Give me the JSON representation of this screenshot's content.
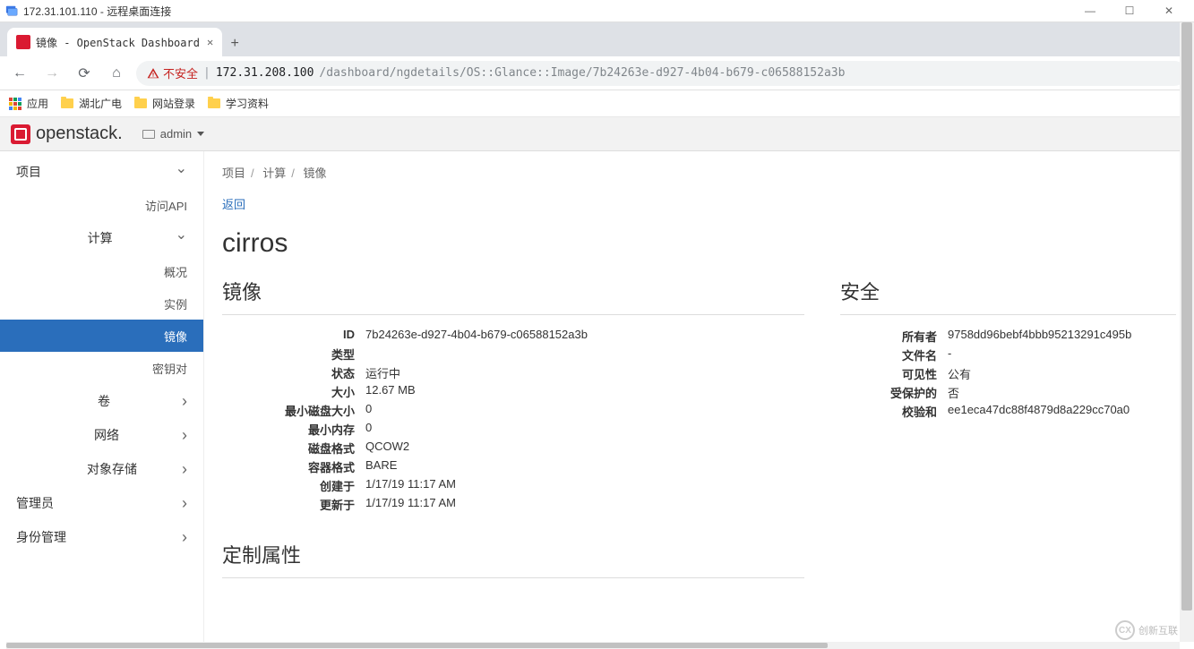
{
  "rdp": {
    "title": "172.31.101.110 - 远程桌面连接"
  },
  "browser": {
    "tab_title": "镜像 - OpenStack Dashboard",
    "insecure_label": "不安全",
    "url_host": "172.31.208.100",
    "url_path": "/dashboard/ngdetails/OS::Glance::Image/7b24263e-d927-4b04-b679-c06588152a3b",
    "bookmarks": {
      "apps": "应用",
      "b1": "湖北广电",
      "b2": "网站登录",
      "b3": "学习资料"
    }
  },
  "openstack": {
    "brand": "openstack.",
    "project_selector": "admin",
    "sidebar": {
      "project": "项目",
      "access_api": "访问API",
      "compute": "计算",
      "overview": "概况",
      "instances": "实例",
      "images": "镜像",
      "keypairs": "密钥对",
      "volumes": "卷",
      "network": "网络",
      "object_storage": "对象存储",
      "admin": "管理员",
      "identity": "身份管理"
    },
    "breadcrumb": {
      "a": "项目",
      "b": "计算",
      "c": "镜像"
    },
    "back": "返回",
    "page_title": "cirros",
    "section_image": "镜像",
    "section_security": "安全",
    "section_custom": "定制属性",
    "image_fields": {
      "id_k": "ID",
      "id_v": "7b24263e-d927-4b04-b679-c06588152a3b",
      "type_k": "类型",
      "type_v": "",
      "status_k": "状态",
      "status_v": "运行中",
      "size_k": "大小",
      "size_v": "12.67 MB",
      "mindisk_k": "最小磁盘大小",
      "mindisk_v": "0",
      "minram_k": "最小内存",
      "minram_v": "0",
      "diskfmt_k": "磁盘格式",
      "diskfmt_v": "QCOW2",
      "contfmt_k": "容器格式",
      "contfmt_v": "BARE",
      "created_k": "创建于",
      "created_v": "1/17/19 11:17 AM",
      "updated_k": "更新于",
      "updated_v": "1/17/19 11:17 AM"
    },
    "security_fields": {
      "owner_k": "所有者",
      "owner_v": "9758dd96bebf4bbb95213291c495b",
      "filename_k": "文件名",
      "filename_v": "-",
      "visibility_k": "可见性",
      "visibility_v": "公有",
      "protected_k": "受保护的",
      "protected_v": "否",
      "checksum_k": "校验和",
      "checksum_v": "ee1eca47dc88f4879d8a229cc70a0"
    }
  },
  "watermark": "创新互联"
}
